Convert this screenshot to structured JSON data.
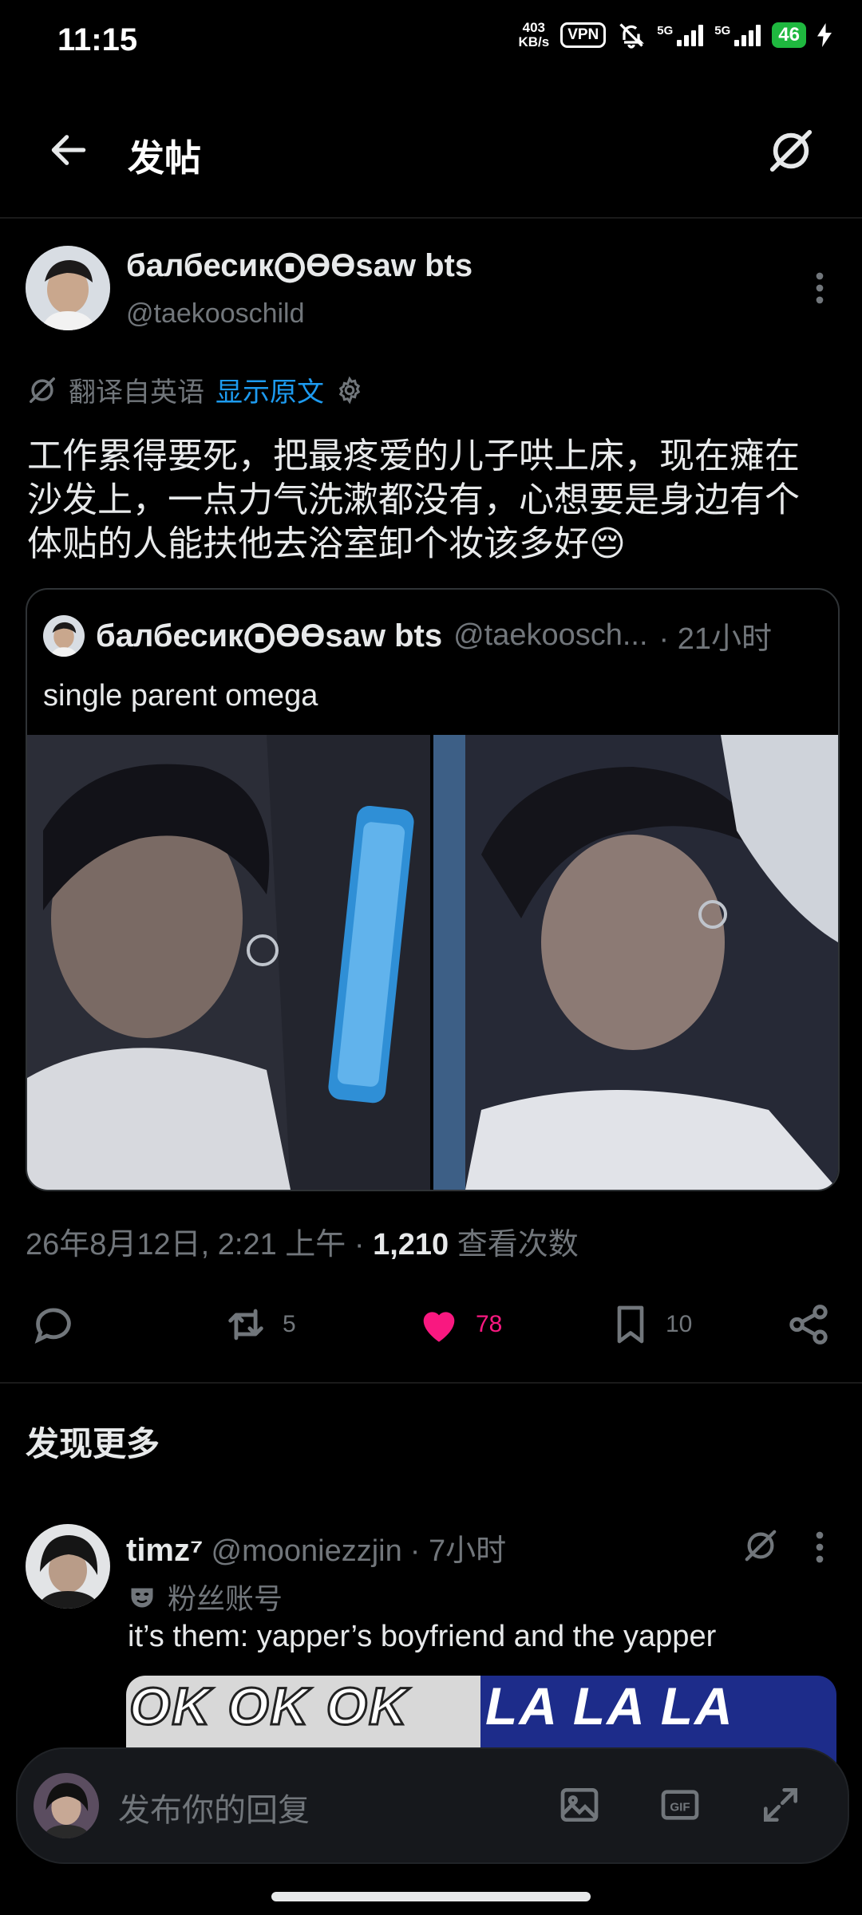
{
  "status_bar": {
    "time": "11:15",
    "speed_value": "403",
    "speed_unit": "KB/s",
    "vpn": "VPN",
    "network_1": "5G",
    "network_2": "5G",
    "battery": "46"
  },
  "header": {
    "title": "发帖"
  },
  "post": {
    "author_name": "балбесик⨀ϴϴsaw bts",
    "author_handle": "@taekooschild",
    "translated_from": "翻译自英语",
    "show_original": "显示原文",
    "text": "工作累得要死，把最疼爱的儿子哄上床，现在瘫在沙发上，一点力气洗漱都没有，心想要是身边有个体贴的人能扶他去浴室卸个妆该多好😔",
    "quote": {
      "author_name": "балбесик⨀ϴϴsaw bts",
      "author_handle": "@taekoosch...",
      "time": "· 21小时",
      "text": "single parent omega"
    },
    "meta_date": "26年8月12日, 2:21 上午",
    "meta_sep": "·",
    "views": "1,210",
    "views_label": "查看次数",
    "retweets": "5",
    "likes": "78",
    "bookmarks": "10"
  },
  "discover": {
    "title": "发现更多",
    "item": {
      "author_name": "timz⁷",
      "author_handle": "@mooniezzjin",
      "time": "· 7小时",
      "badge": "粉丝账号",
      "text": "it’s them: yapper’s boyfriend and the yapper",
      "image_text_left": "OK OK OK",
      "image_text_right": "LA LA LA"
    }
  },
  "reply": {
    "placeholder": "发布你的回复"
  },
  "colors": {
    "accent": "#1d9bf0",
    "like": "#f91880",
    "muted": "#71767b",
    "battery": "#1fb83f"
  }
}
